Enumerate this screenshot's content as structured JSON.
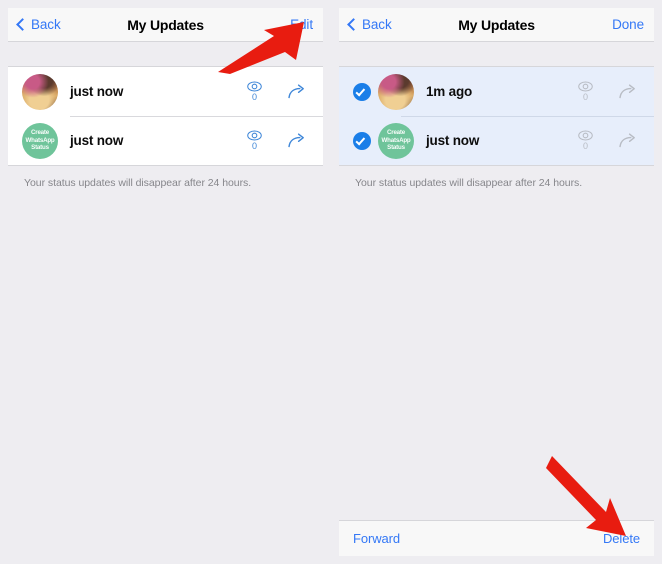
{
  "meta": {
    "accent_blue": "#3478f6",
    "icon_blue": "#3f87d8",
    "icon_disabled": "#b8bcc4",
    "check_blue": "#1a7ee8",
    "create_green": "#6fc49a",
    "annotation_red": "#e81c10",
    "panel_bg": "#eeedf1",
    "row_bg": "#ffffff",
    "row_selected_bg": "#e7eefb"
  },
  "panels": [
    {
      "id": "normal-mode",
      "navbar": {
        "back_label": "Back",
        "title": "My Updates",
        "action_label": "Edit"
      },
      "rows": [
        {
          "selected": false,
          "avatar_type": "photo",
          "avatar_text": "",
          "label": "just now",
          "views_count": "0"
        },
        {
          "selected": false,
          "avatar_type": "create",
          "avatar_text": "Create WhatsApp Status",
          "label": "just now",
          "views_count": "0"
        }
      ],
      "note": "Your status updates will disappear after 24 hours.",
      "toolbar": null
    },
    {
      "id": "edit-mode",
      "navbar": {
        "back_label": "Back",
        "title": "My Updates",
        "action_label": "Done"
      },
      "rows": [
        {
          "selected": true,
          "avatar_type": "photo",
          "avatar_text": "",
          "label": "1m ago",
          "views_count": "0"
        },
        {
          "selected": true,
          "avatar_type": "create",
          "avatar_text": "Create WhatsApp Status",
          "label": "just now",
          "views_count": "0"
        }
      ],
      "note": "Your status updates will disappear after 24 hours.",
      "toolbar": {
        "forward_label": "Forward",
        "delete_label": "Delete"
      }
    }
  ],
  "annotations": [
    {
      "id": "arrow-to-edit",
      "target": "Edit"
    },
    {
      "id": "arrow-to-delete",
      "target": "Delete"
    }
  ]
}
